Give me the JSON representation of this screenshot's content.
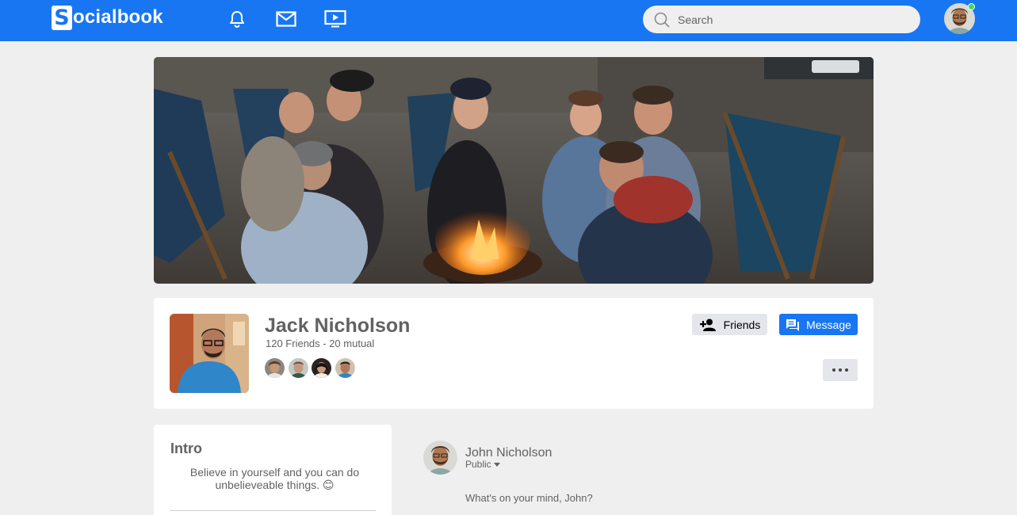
{
  "navbar": {
    "logo_mark": "S",
    "logo_text": "ocialbook",
    "icons": [
      "bell-icon",
      "mail-icon",
      "video-icon"
    ],
    "search_placeholder": "Search",
    "status": "online"
  },
  "profile": {
    "name": "Jack Nicholson",
    "subtitle": "120 Friends - 20 mutual",
    "friends_button": "Friends",
    "message_button": "Message",
    "mutual_avatar_count": 4
  },
  "intro": {
    "title": "Intro",
    "text": "Believe in yourself and you can do unbelieveable things. 😊"
  },
  "composer": {
    "user_name": "John Nicholson",
    "privacy": "Public",
    "placeholder": "What's on your mind, John?"
  },
  "colors": {
    "primary": "#1876f2",
    "background": "#efefef",
    "text": "#626262",
    "button_grey": "#e4e6eb",
    "online": "#41db51"
  }
}
